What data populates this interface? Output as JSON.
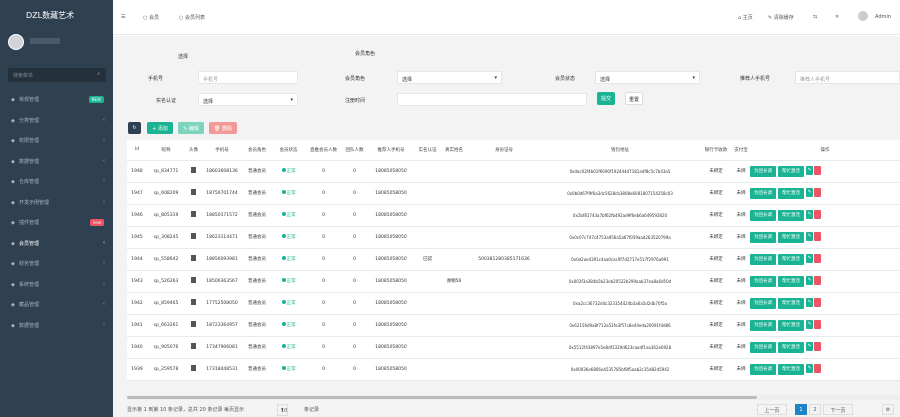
{
  "app": {
    "title": "DZL数藏艺术"
  },
  "sidebar": {
    "search_placeholder": "搜索菜单",
    "items": [
      {
        "label": "常规管理",
        "icon": "gear-icon",
        "badge": "NEW",
        "badge_color": "#1ab394"
      },
      {
        "label": "分类管理",
        "icon": "leaf-icon"
      },
      {
        "label": "权限管理",
        "icon": "users-icon"
      },
      {
        "label": "数据管理",
        "icon": "circle-icon"
      },
      {
        "label": "仓库管理",
        "icon": "circle-icon"
      },
      {
        "label": "开发示例管理",
        "icon": "magic-icon"
      },
      {
        "label": "插件管理",
        "icon": "cube-icon",
        "badge": "new",
        "badge_color": "#ed5565"
      },
      {
        "label": "会员管理",
        "icon": "user-icon"
      },
      {
        "label": "财务管理",
        "icon": "circle-icon"
      },
      {
        "label": "系统管理",
        "icon": "circle-icon"
      },
      {
        "label": "藏品管理",
        "icon": "circle-icon"
      },
      {
        "label": "数据管理",
        "icon": "circle-icon"
      }
    ]
  },
  "topbar": {
    "tab1": "会员",
    "tab2": "会员列表",
    "home": "主页",
    "clear": "清除缓存",
    "admin": "Admin"
  },
  "filters": {
    "f0_label": "选择",
    "f1_label": "会员角色",
    "phone_label": "手机号",
    "phone_ph": "手机号",
    "role_label": "会员角色",
    "role_value": "选择",
    "status_label": "会员状态",
    "status_value": "选择",
    "parent_label": "推荐人手机号",
    "parent_ph": "推荐人手机号",
    "real_label": "实名认证",
    "real_value": "选择",
    "time_label": "注册时间",
    "submit": "提交",
    "reset": "重置"
  },
  "toolbar": {
    "add": "添加",
    "edit": "编辑",
    "del": "删除"
  },
  "colors": {
    "green": "#1ab394",
    "blue": "#1c84c6",
    "red": "#ed5565",
    "yellow": "#f8ac59",
    "sidebar": "#2f4050"
  },
  "table": {
    "headers": [
      "Id",
      "昵称",
      "头像",
      "手机号",
      "会员角色",
      "会员状态",
      "直推会员人数",
      "团队人数",
      "推荐人手机号",
      "实名认证",
      "真实姓名",
      "身份证号",
      "钱包地址",
      "银行卡收款",
      "支付宝",
      "操作"
    ],
    "rows": [
      [
        "1948",
        "sp_834771",
        "",
        "18603608136",
        "普通会员",
        "正常",
        "0",
        "0",
        "18085058050",
        "",
        "",
        "",
        "0xdac02f4b01f6690f192444d7181a4f8c5c7b43a5",
        "未绑定",
        "未绑"
      ],
      [
        "1947",
        "sp_608209",
        "",
        "18756701744",
        "普通会员",
        "正常",
        "0",
        "0",
        "18085058050",
        "",
        "",
        "",
        "0x0b0d67f9f6a3dc5628cb3808e6081807154258c03",
        "未绑定",
        "未绑"
      ],
      [
        "1946",
        "sp_805319",
        "",
        "18850171572",
        "普通会员",
        "正常",
        "0",
        "0",
        "18085058050",
        "",
        "",
        "",
        "0x2bf81743a7bf62fb492ad9f6eb6a649592820",
        "未绑定",
        "未绑"
      ],
      [
        "1945",
        "sp_308245",
        "",
        "18623114471",
        "普通会员",
        "正常",
        "0",
        "0",
        "18085058050",
        "",
        "",
        "",
        "0x0c07c747c4753a956a5a67f059aad263520799a",
        "未绑定",
        "未绑"
      ],
      [
        "1944",
        "sp_558642",
        "",
        "18856093981",
        "普通会员",
        "正常",
        "0",
        "0",
        "18085058050",
        "已認",
        "",
        "500381280385171636",
        "0x0d2ae4391c4aa0cac9f7d2717e517f2976a991",
        "未绑定",
        "未绑"
      ],
      [
        "1943",
        "sp_526263",
        "",
        "18506363567",
        "普通会员",
        "正常",
        "0",
        "0",
        "18085058050",
        "",
        "谢桐56",
        "",
        "0x002f3a384b5b23eb20522b299aab37ea8a6d50d",
        "未绑定",
        "未绑"
      ],
      [
        "1942",
        "sp_859465",
        "",
        "17752508050",
        "普通会员",
        "正常",
        "0",
        "0",
        "18085058050",
        "",
        "",
        "",
        "0xa2cc36732d4c323354424b3a6a5d2db70f5a",
        "未绑定",
        "未绑"
      ],
      [
        "1941",
        "sp_663261",
        "",
        "18723364957",
        "普通会员",
        "正常",
        "0",
        "0",
        "18085058050",
        "",
        "",
        "",
        "0x62156d9a8f712e51fe3f57c8e44eda20091fdd86",
        "未绑定",
        "未绑"
      ],
      [
        "1940",
        "sp_905076",
        "",
        "17347906081",
        "普通会员",
        "正常",
        "0",
        "0",
        "18085058050",
        "",
        "",
        "",
        "0x5512f43897e5e8df1329d623caadf1ea362e6928",
        "未绑定",
        "未绑"
      ],
      [
        "1939",
        "sp_259578",
        "",
        "17318448531",
        "普通会员",
        "正常",
        "0",
        "0",
        "18085058050",
        "",
        "",
        "",
        "0x00936e6806e4535785bf8f5aab2c35d82d5942",
        "未绑定",
        "未绑"
      ]
    ],
    "action1": "为团长调",
    "action2": "帮忙激活"
  },
  "footer": {
    "info": "显示第 1 到第 10 条记录，总共 20 条记录 每页显示",
    "per_page": "10",
    "suffix": "条记录",
    "prev": "上一页",
    "p1": "1",
    "p2": "2",
    "next": "下一页"
  }
}
